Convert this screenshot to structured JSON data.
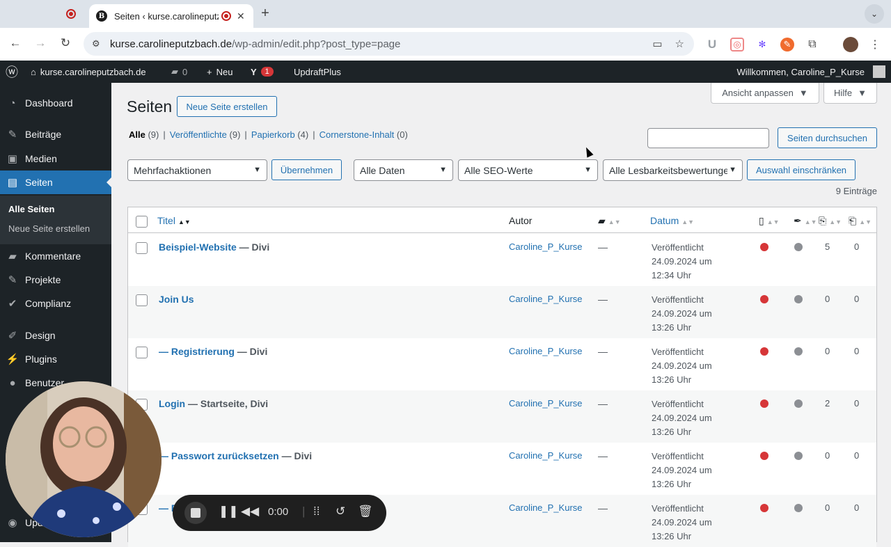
{
  "browser": {
    "tab_title": "Seiten ‹ kurse.carolineputzbach.de",
    "url_host": "kurse.carolineputzbach.de",
    "url_path": "/wp-admin/edit.php?post_type=page"
  },
  "adminbar": {
    "site_name": "kurse.carolineputzbach.de",
    "comments_count": "0",
    "new_label": "Neu",
    "yoast_badge": "1",
    "updraft_label": "UpdraftPlus",
    "welcome": "Willkommen, Caroline_P_Kurse"
  },
  "sidebar": {
    "items": [
      {
        "label": "Dashboard"
      },
      {
        "label": "Beiträge"
      },
      {
        "label": "Medien"
      },
      {
        "label": "Seiten"
      },
      {
        "label": "Kommentare"
      },
      {
        "label": "Projekte"
      },
      {
        "label": "Complianz"
      },
      {
        "label": "Design"
      },
      {
        "label": "Plugins"
      },
      {
        "label": "Benutzer"
      }
    ],
    "submenu": [
      "Alle Seiten",
      "Neue Seite erstellen"
    ],
    "bottom_partial": "Upd"
  },
  "screen": {
    "options_label": "Ansicht anpassen",
    "help_label": "Hilfe"
  },
  "main": {
    "title": "Seiten",
    "add_new": "Neue Seite erstellen",
    "filters": {
      "all": "Alle",
      "all_count": "(9)",
      "published": "Veröffentlichte",
      "published_count": "(9)",
      "trash": "Papierkorb",
      "trash_count": "(4)",
      "cornerstone": "Cornerstone-Inhalt",
      "cornerstone_count": "(0)"
    },
    "search_button": "Seiten durchsuchen",
    "bulk_action": "Mehrfachaktionen",
    "apply": "Übernehmen",
    "dates": "Alle Daten",
    "seo": "Alle SEO-Werte",
    "readability": "Alle Lesbarkeitsbewertungen",
    "filter_button": "Auswahl einschränken",
    "count": "9 Einträge"
  },
  "table": {
    "headers": {
      "title": "Titel",
      "author": "Autor",
      "date": "Datum"
    },
    "rows": [
      {
        "title": "Beispiel-Website",
        "state": " — Divi",
        "author": "Caroline_P_Kurse",
        "comments": "—",
        "status": "Veröffentlicht",
        "date": "24.09.2024 um",
        "time": "12:34 Uhr",
        "links_out": "5",
        "links_in": "0"
      },
      {
        "title": "Join Us",
        "state": "",
        "author": "Caroline_P_Kurse",
        "comments": "—",
        "status": "Veröffentlicht",
        "date": "24.09.2024 um",
        "time": "13:26 Uhr",
        "links_out": "0",
        "links_in": "0"
      },
      {
        "title": "— Registrierung",
        "state": " — Divi",
        "author": "Caroline_P_Kurse",
        "comments": "—",
        "status": "Veröffentlicht",
        "date": "24.09.2024 um",
        "time": "13:26 Uhr",
        "links_out": "0",
        "links_in": "0"
      },
      {
        "title": "Login",
        "state": " — Startseite, Divi",
        "author": "Caroline_P_Kurse",
        "comments": "—",
        "status": "Veröffentlicht",
        "date": "24.09.2024 um",
        "time": "13:26 Uhr",
        "links_out": "2",
        "links_in": "0"
      },
      {
        "title": "— Passwort zurücksetzen",
        "state": " — Divi",
        "author": "Caroline_P_Kurse",
        "comments": "—",
        "status": "Veröffentlicht",
        "date": "24.09.2024 um",
        "time": "13:26 Uhr",
        "links_out": "0",
        "links_in": "0"
      },
      {
        "title": "— R",
        "state": "",
        "author": "Caroline_P_Kurse",
        "comments": "—",
        "status": "Veröffentlicht",
        "date": "24.09.2024 um",
        "time": "13:26 Uhr",
        "links_out": "0",
        "links_in": "0"
      }
    ]
  },
  "recorder": {
    "time": "0:00"
  },
  "colors": {
    "seo_dot": "#d63638",
    "readability_dot": "#8c8f94",
    "accent": "#2271b1"
  }
}
